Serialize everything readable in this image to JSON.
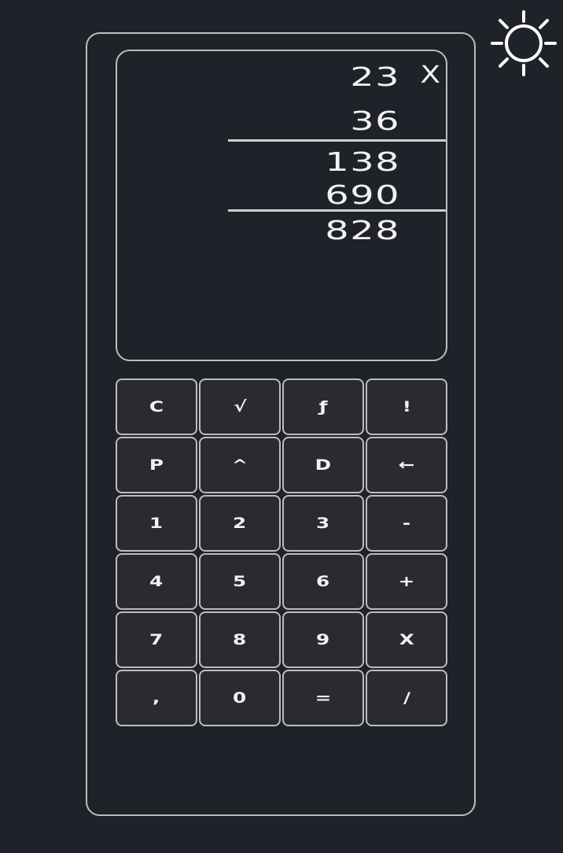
{
  "theme_toggle": {
    "icon": "sun-icon"
  },
  "display": {
    "operand1": "23",
    "operator": "X",
    "operand2": "36",
    "partial1": "138",
    "partial2": "690",
    "result": "828"
  },
  "keypad": {
    "keys": [
      {
        "label": "C"
      },
      {
        "label": "√"
      },
      {
        "label": "ƒ"
      },
      {
        "label": "!"
      },
      {
        "label": "P"
      },
      {
        "label": "^"
      },
      {
        "label": "D"
      },
      {
        "label": "←"
      },
      {
        "label": "1"
      },
      {
        "label": "2"
      },
      {
        "label": "3"
      },
      {
        "label": "-"
      },
      {
        "label": "4"
      },
      {
        "label": "5"
      },
      {
        "label": "6"
      },
      {
        "label": "+"
      },
      {
        "label": "7"
      },
      {
        "label": "8"
      },
      {
        "label": "9"
      },
      {
        "label": "X"
      },
      {
        "label": ","
      },
      {
        "label": "0"
      },
      {
        "label": "="
      },
      {
        "label": "/"
      }
    ]
  },
  "colors": {
    "background": "#202229",
    "border": "#bdbdbf",
    "key_background": "#2a2b30",
    "text": "#f2f2f2"
  }
}
